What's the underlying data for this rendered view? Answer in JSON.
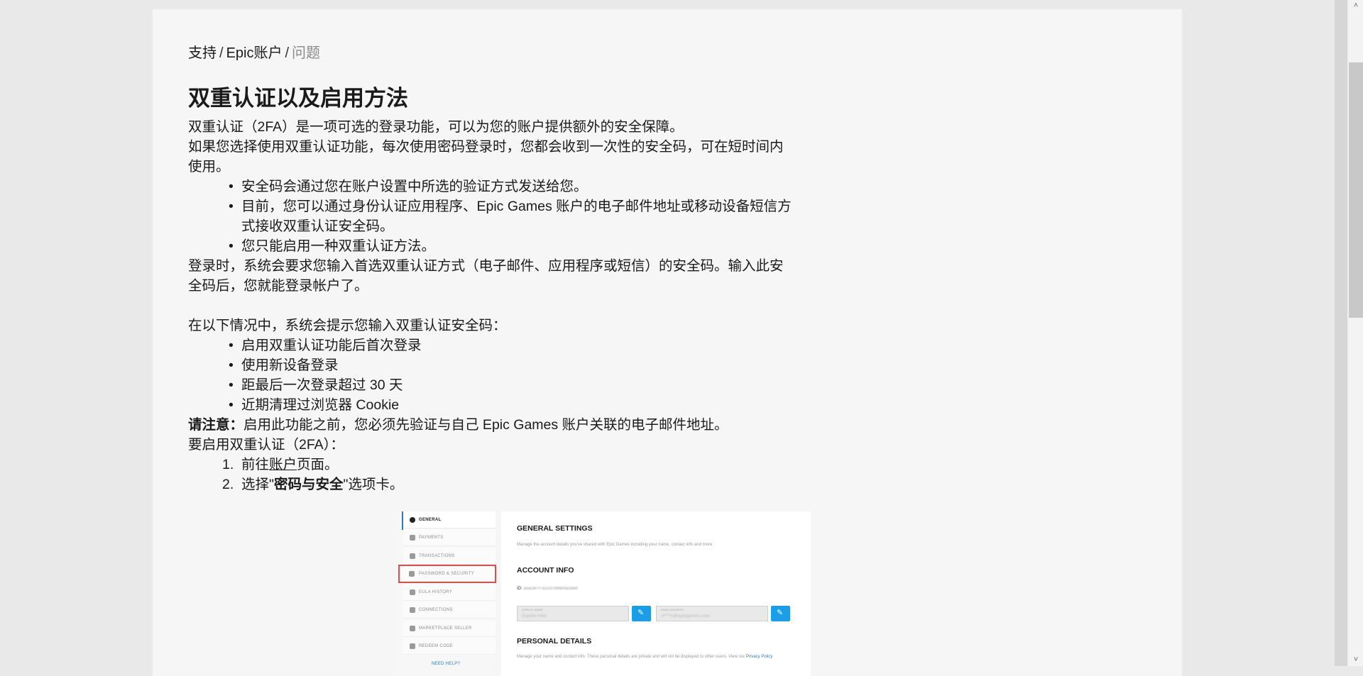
{
  "breadcrumb": {
    "items": [
      "支持",
      "Epic账户"
    ],
    "current": "问题",
    "separator": "/"
  },
  "article": {
    "title": "双重认证以及启用方法",
    "intro1": "双重认证（2FA）是一项可选的登录功能，可以为您的账户提供额外的安全保障。",
    "intro2": "如果您选择使用双重认证功能，每次使用密码登录时，您都会收到一次性的安全码，可在短时间内使用。",
    "bullets1": [
      "安全码会通过您在账户设置中所选的验证方式发送给您。",
      "目前，您可以通过身份认证应用程序、Epic Games 账户的电子邮件地址或移动设备短信方式接收双重认证安全码。",
      "您只能启用一种双重认证方法。"
    ],
    "login_text": "登录时，系统会要求您输入首选双重认证方式（电子邮件、应用程序或短信）的安全码。输入此安全码后，您就能登录帐户了。",
    "cases_intro": "在以下情况中，系统会提示您输入双重认证安全码：",
    "bullets2": [
      "启用双重认证功能后首次登录",
      "使用新设备登录",
      "距最后一次登录超过 30 天",
      "近期清理过浏览器 Cookie"
    ],
    "note_label": "请注意：",
    "note_text": "启用此功能之前，您必须先验证与自己 Epic Games 账户关联的电子邮件地址。",
    "enable_intro": "要启用双重认证（2FA）：",
    "steps": [
      {
        "num": "1.",
        "pre": "前往",
        "link": "账户",
        "post": "页面。"
      },
      {
        "num": "2.",
        "pre": "选择\"",
        "bold": "密码与安全",
        "post": "\"选项卡。"
      }
    ]
  },
  "screenshot": {
    "sidebar": [
      {
        "label": "GENERAL",
        "icon": "user-icon"
      },
      {
        "label": "PAYMENTS",
        "icon": "card-icon"
      },
      {
        "label": "TRANSACTIONS",
        "icon": "history-icon"
      },
      {
        "label": "PASSWORD & SECURITY",
        "icon": "key-icon"
      },
      {
        "label": "EULA HISTORY",
        "icon": "document-icon"
      },
      {
        "label": "CONNECTIONS",
        "icon": "share-icon"
      },
      {
        "label": "MARKETPLACE SELLER",
        "icon": "person-icon"
      },
      {
        "label": "REDEEM CODE",
        "icon": "gift-icon"
      }
    ],
    "need_help": "NEED HELP?",
    "general_settings": "GENERAL SETTINGS",
    "general_sub": "Manage the account details you've shared with Epic Games including your name, contact info and more",
    "account_info": "ACCOUNT INFO",
    "id_label": "ID:",
    "id_value": "a3a2ef7f7a2cd7d4de4a3ded",
    "display_name_label": "DISPLAY NAME",
    "display_name_value": "Sophie Hein",
    "email_label": "EMAIL ADDRESS",
    "email_value": "s****n@epicgames.com",
    "personal_details": "PERSONAL DETAILS",
    "personal_sub": "Manage your name and contact info. These personal details are private and will not be displayed to other users. View our",
    "privacy_policy": "Privacy Policy"
  },
  "colors": {
    "accent": "#1a9ee8",
    "highlight": "#e24b4b",
    "link": "#2a7bc4"
  }
}
